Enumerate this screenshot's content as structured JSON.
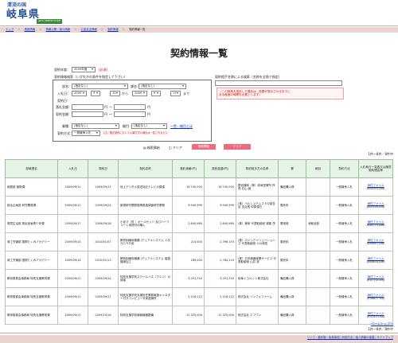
{
  "header": {
    "logo_small": "清流の国",
    "logo_big": "岐阜県",
    "logo_sub": "GIFU PREFECTURE"
  },
  "breadcrumb": [
    "トップ",
    "県政情報",
    "情報公開・個人情報",
    "公金支出情報",
    "契約情報",
    "契約情報一覧"
  ],
  "title": "契約情報一覧",
  "form": {
    "year_label": "契約年度：",
    "year_value": "2009年度",
    "required": "(必須)",
    "conditions_heading": "契約情報検索（いずれかの条件を指定して下さい）",
    "bu_label": "部名：",
    "bu_value": "(指定なし)",
    "ka_label": "課名：",
    "ka_value": "(指定なし)",
    "nyusatsu_label": "入札日：",
    "date_from": {
      "year": "2009",
      "month": "9",
      "day": "10"
    },
    "date_to": {
      "year": "2009",
      "month": "9",
      "day": "17"
    },
    "kara": "から",
    "made": "まで",
    "keiyakubi_label": "契約日：",
    "kingaku_label": "落札金額：",
    "keiyaku_kingaku_label": "契約金額：",
    "yen": "円",
    "range_sep": "〜",
    "gyoshu_label": "業種：",
    "gyoshu_value": "(指定なし)",
    "saimoku_label": "細目：",
    "saimoku_value": "(指定なし)",
    "list_link": "一覧・細目とは",
    "hoshiki_label": "契約方式：",
    "hoshiki_value": "一般競争入札",
    "hoshiki_note": "(注）随意契約において公募方式の場合は一覧されません",
    "partner_heading": "契約相手名称による検索（名称を全角で指定）",
    "partner_note_line1": "（この検索を指定した場合は、結果が表示されるまでに",
    "partner_note_line2": "ある程度の時間を必要とします）",
    "search_start_label": "検索開始",
    "clear_label": "クリア",
    "search_button": "検索開始",
    "clear_button": "クリア"
  },
  "hits": "1件〜8件／8件中",
  "table": {
    "headers": [
      "部局課名",
      "入札日",
      "契約日",
      "契約名称",
      "落札価格(円)",
      "契約金額(円)",
      "契約相手方の名称",
      "業",
      "細目",
      "契約方法",
      "入札執行一覧表又は随意契約理由等"
    ],
    "rows": [
      [
        "総務部 管財課",
        "2009/09/11",
        "2009/09/17",
        "地上デジタル放送対応テレビの調達",
        "19,740,000",
        "19,740,000",
        "数冠通商（株）岐阜営業所 所長 石山 誠",
        "備品購入費",
        "",
        "一般競争入札",
        "添付ファイル",
        "(K06553.pdf)"
      ],
      [
        "総合企画部 研究開発課",
        "2009/09/11",
        "2009/09/24",
        "新規研究開発施策推進調査研究業務",
        "9,940,999",
        "9,940,999",
        "(株）ベルシステム２４中部支店 支店長 仲原達巳",
        "委託料",
        "",
        "一般競争入札",
        "添付ファイル",
        "(K06559.pdf)"
      ],
      [
        "環境生活部 県民参画青少年課",
        "2009/09/17",
        "2009/09/18",
        "小径マ（質 ）ボールセット 及びハーフコート用資材の購入",
        "2,640,960",
        "2,640,960",
        "(株）美研 代表取締役 清藤 茂",
        "需用費",
        "消耗品費",
        "一般競争入札",
        "添付ファイル",
        "(K06721.pdf)"
      ],
      [
        "商工労働部 国際たくみアカデミー",
        "2009/09/14",
        "2010/01/07",
        "教育訓練用機器 (デュアルシステム ２次元ＣＡＤ用",
        "210,000",
        "2,396,153",
        "(株）ロジックソリューションズ 代表取締役 小川和宏",
        "委託料",
        "",
        "一般競争入札",
        "添付ファイル",
        "(K06607.pdf)"
      ],
      [
        "商工労働部 国際たくみアカデミー",
        "2009/09/14",
        "2010/01/13",
        "教育訓練用機器 (デュアルシステム 複雑機械加工",
        "189,000",
        "2,784,119",
        "(株）日本機器事業サービス 代表取締役 山井 憲",
        "委託料",
        "",
        "一般競争入札",
        "添付ファイル",
        "(K06634.pdf)"
      ],
      [
        "教育委員会事務局 特別支援教育課",
        "2009/09/11",
        "2009/09/14",
        "特別支援学校スクールバス（ウエン）の調達",
        "3,291,750",
        "3,291,750",
        "岐阜トヨペット株式会社",
        "備品購入費",
        "",
        "一般競争入札",
        "添付ファイル",
        "(K07114.xls)"
      ],
      [
        "教育委員会事務局 特別支援教育課",
        "2009/09/11",
        "2009/09/17",
        "特別支援学校支援担任業務実施キャスター付きコンピュータ実習機材",
        "2,216,172",
        "2,216,172",
        "株式会社 インフォファーム",
        "備品購入費",
        "",
        "一般競争入札",
        "添付ファイル",
        "(K06827.xls)"
      ],
      [
        "教育委員会事務局 特別支援教育課",
        "2009/09/11",
        "2009/10/16",
        "特別支援学校情報機器整備",
        "17,325,000",
        "17,325,000",
        "株式会社 エフワン",
        "備品購入費",
        "",
        "一般競争入札",
        "添付ファイル",
        "(K07033.xls)"
      ]
    ]
  },
  "pagetop": "ページトップへ",
  "hits_bottom": "1件〜8件／8件中",
  "footer": "リンク・著作権・免責事項 | 利用方法 | 個人情報の保護 | サイトマップ"
}
